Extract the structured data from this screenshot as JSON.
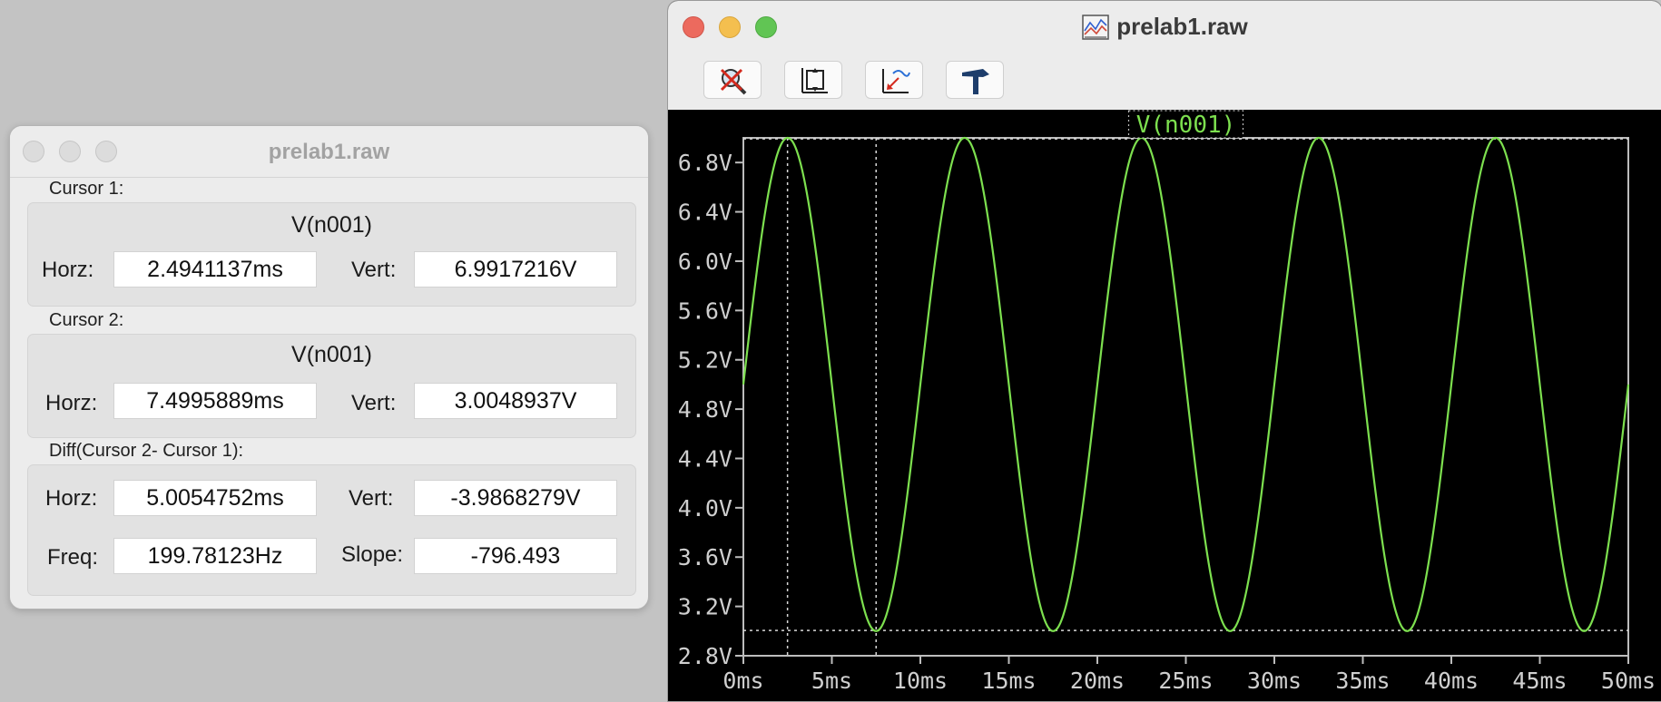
{
  "cursor_window": {
    "title": "prelab1.raw",
    "cursor1": {
      "label": "Cursor 1:",
      "signal": "V(n001)",
      "horz_label": "Horz:",
      "horz": "2.4941137ms",
      "vert_label": "Vert:",
      "vert": "6.9917216V"
    },
    "cursor2": {
      "label": "Cursor 2:",
      "signal": "V(n001)",
      "horz_label": "Horz:",
      "horz": "7.4995889ms",
      "vert_label": "Vert:",
      "vert": "3.0048937V"
    },
    "diff": {
      "label": "Diff(Cursor 2- Cursor 1):",
      "horz_label": "Horz:",
      "horz": "5.0054752ms",
      "vert_label": "Vert:",
      "vert": "-3.9868279V",
      "freq_label": "Freq:",
      "freq": "199.78123Hz",
      "slope_label": "Slope:",
      "slope": "-796.493"
    }
  },
  "plot_window": {
    "title": "prelab1.raw",
    "toolbar": [
      {
        "icon": "zoom-cancel-icon"
      },
      {
        "icon": "autorange-icon"
      },
      {
        "icon": "rescale-icon"
      },
      {
        "icon": "hammer-icon"
      }
    ]
  },
  "colors": {
    "trace": "#7de04f",
    "plot_bg": "#000000",
    "grid_frame": "#bdbdbd",
    "axis_text": "#cfcfcf",
    "close": "#ec6a5e",
    "minimize": "#f4bf4f",
    "zoom": "#61c554"
  },
  "chart_data": {
    "type": "line",
    "title": "V(n001)",
    "xlim": [
      0,
      50
    ],
    "ylim": [
      2.8,
      7.0
    ],
    "x_ticks": [
      "0ms",
      "5ms",
      "10ms",
      "15ms",
      "20ms",
      "25ms",
      "30ms",
      "35ms",
      "40ms",
      "45ms",
      "50ms"
    ],
    "y_ticks": [
      "2.8V",
      "3.2V",
      "3.6V",
      "4.0V",
      "4.4V",
      "4.8V",
      "5.2V",
      "5.6V",
      "6.0V",
      "6.4V",
      "6.8V"
    ],
    "series": [
      {
        "name": "V(n001)",
        "function": "sine",
        "offset": 5.0,
        "amplitude": 2.0,
        "frequency_hz": 100,
        "start_phase_deg": 0
      }
    ],
    "cursors": [
      {
        "x": 2.4941137,
        "y": 6.9917216
      },
      {
        "x": 7.4995889,
        "y": 3.0048937
      }
    ]
  }
}
